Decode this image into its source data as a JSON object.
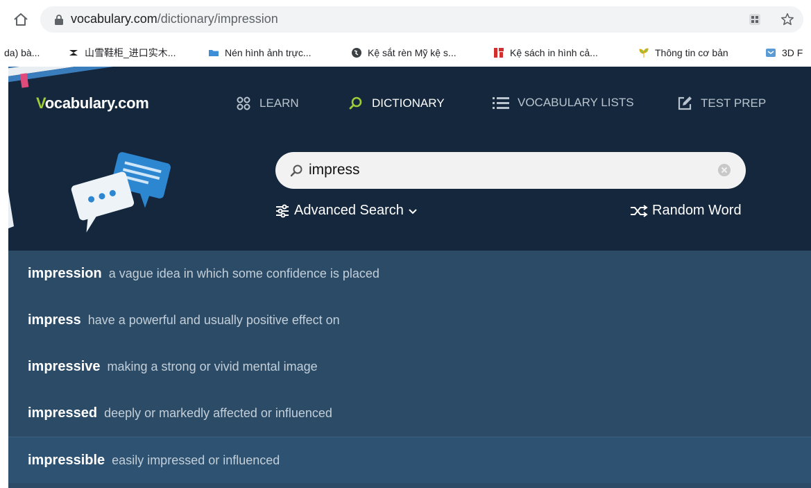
{
  "browser": {
    "url_domain": "vocabulary.com",
    "url_path": "/dictionary/impression",
    "bookmarks": [
      {
        "label": "da) bà...",
        "icon": "bookmark-text"
      },
      {
        "label": "山雪鞋柜_进口实木...",
        "icon": "bookmark-black-logo"
      },
      {
        "label": "Nén hình ảnh trực...",
        "icon": "folder-blue-icon"
      },
      {
        "label": "Kệ sắt rèn Mỹ kệ s...",
        "icon": "globe-icon"
      },
      {
        "label": "Kệ sách in hình cả...",
        "icon": "red-logo-icon"
      },
      {
        "label": "Thông tin cơ bản",
        "icon": "plant-icon"
      },
      {
        "label": "3D F",
        "icon": "blue-box-icon"
      }
    ]
  },
  "site": {
    "logo": {
      "first": "V",
      "rest": "ocabulary.com"
    },
    "nav": [
      {
        "label": "LEARN",
        "icon": "grid-circles-icon",
        "active": false
      },
      {
        "label": "DICTIONARY",
        "icon": "search-icon",
        "active": true
      },
      {
        "label": "VOCABULARY LISTS",
        "icon": "list-icon",
        "active": false
      },
      {
        "label": "TEST PREP",
        "icon": "edit-icon",
        "active": false
      }
    ],
    "search": {
      "value": "impress"
    },
    "advanced_search": "Advanced Search",
    "random_word": "Random Word",
    "suggestions": [
      {
        "word": "impression",
        "definition": "a vague idea in which some confidence is placed"
      },
      {
        "word": "impress",
        "definition": "have a powerful and usually positive effect on"
      },
      {
        "word": "impressive",
        "definition": "making a strong or vivid mental image"
      },
      {
        "word": "impressed",
        "definition": "deeply or markedly affected or influenced"
      },
      {
        "word": "impressible",
        "definition": "easily impressed or influenced"
      }
    ]
  },
  "colors": {
    "header_bg": "#14273c",
    "suggestions_bg": "#2b4b67",
    "logo_accent": "#9ccc3a",
    "active_nav_icon": "#9ccc3a"
  }
}
